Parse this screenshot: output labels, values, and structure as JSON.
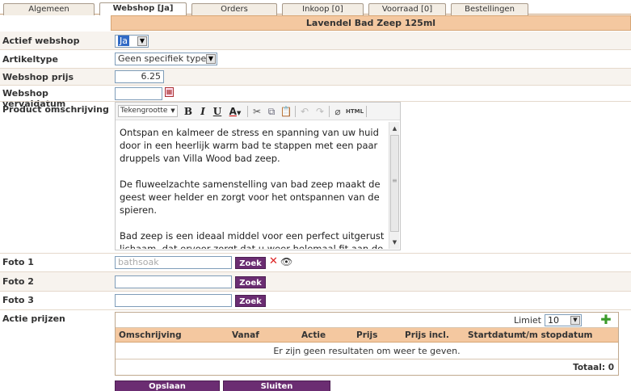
{
  "tabs": [
    {
      "label": "Algemeen"
    },
    {
      "label": "Webshop [Ja]"
    },
    {
      "label": "Orders"
    },
    {
      "label": "Inkoop [0]"
    },
    {
      "label": "Voorraad [0]"
    },
    {
      "label": "Bestellingen"
    }
  ],
  "title": "Lavendel Bad Zeep 125ml",
  "fields": {
    "actief_webshop": {
      "label": "Actief webshop",
      "value": "Ja"
    },
    "artikeltype": {
      "label": "Artikeltype",
      "value": "Geen specifiek type"
    },
    "webshop_prijs": {
      "label": "Webshop prijs",
      "value": "6.25"
    },
    "webshop_vervaldatum": {
      "label": "Webshop vervaldatum",
      "value": ""
    },
    "product_omschrijving": {
      "label": "Product omschrijving"
    },
    "foto1": {
      "label": "Foto 1",
      "value": "bathsoak"
    },
    "foto2": {
      "label": "Foto 2",
      "value": ""
    },
    "foto3": {
      "label": "Foto 3",
      "value": ""
    },
    "actie_prijzen": {
      "label": "Actie prijzen"
    }
  },
  "editor": {
    "font_size_label": "Tekengrootte",
    "paragraphs": [
      "Ontspan en kalmeer de stress en spanning van uw huid door in een heerlijk warm bad te stappen met een paar druppels van Villa Wood bad zeep.",
      "De fluweelzachte samenstelling van bad zeep maakt de geest weer helder en zorgt voor het ontspannen van de spieren.",
      "Bad zeep is een ideaal middel voor een perfect uitgerust lichaam, dat ervoor zorgt dat u weer helemaal fit aan de dag begint."
    ],
    "html_label": "HTML"
  },
  "zoek_label": "Zoek",
  "grid": {
    "limiet_label": "Limiet",
    "limiet_value": "10",
    "columns": [
      "Omschrijving",
      "Vanaf",
      "Actie",
      "Prijs",
      "Prijs incl.",
      "Startdatum",
      "t/m stopdatum"
    ],
    "empty_message": "Er zijn geen resultaten om weer te geven.",
    "totaal": "Totaal: 0"
  },
  "buttons": {
    "opslaan": "Opslaan",
    "sluiten": "Sluiten"
  },
  "colors": {
    "header_bg": "#f4c8a0",
    "button_bg": "#6b2d72",
    "plus_icon": "#3a9a2a"
  }
}
